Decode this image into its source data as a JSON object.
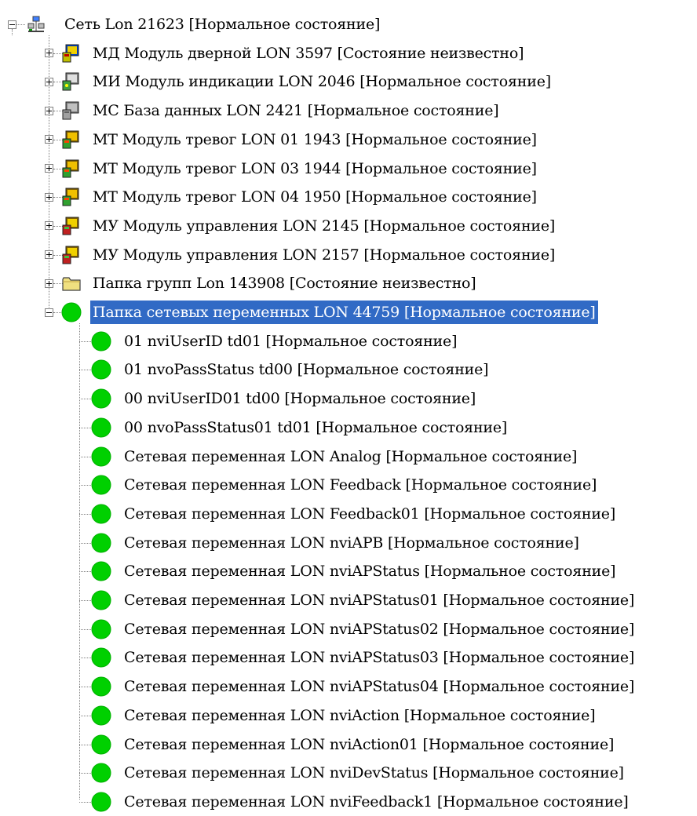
{
  "tree": {
    "root": {
      "label": "Сеть Lon 21623 [Нормальное состояние]",
      "icon": "network-icon",
      "expanded": true
    },
    "children": [
      {
        "label": "МД Модуль дверной LON 3597 [Состояние неизвестно]",
        "icon": "door-module-icon",
        "expanded": false
      },
      {
        "label": "МИ Модуль индикации LON 2046 [Нормальное состояние]",
        "icon": "indication-module-icon",
        "expanded": false
      },
      {
        "label": "МС База данных LON 2421 [Нормальное состояние]",
        "icon": "database-module-icon",
        "expanded": false
      },
      {
        "label": "МТ Модуль тревог LON 01 1943 [Нормальное состояние]",
        "icon": "alarm-module-icon",
        "expanded": false
      },
      {
        "label": "МТ Модуль тревог LON 03 1944 [Нормальное состояние]",
        "icon": "alarm-module-icon",
        "expanded": false
      },
      {
        "label": "МТ Модуль тревог LON 04 1950 [Нормальное состояние]",
        "icon": "alarm-module-icon",
        "expanded": false
      },
      {
        "label": "МУ Модуль управления LON 2145 [Нормальное состояние]",
        "icon": "control-module-icon",
        "expanded": false
      },
      {
        "label": "МУ Модуль управления LON 2157 [Нормальное состояние]",
        "icon": "control-module-icon",
        "expanded": false
      },
      {
        "label": "Папка групп Lon 143908 [Состояние неизвестно]",
        "icon": "folder-icon",
        "expanded": false
      },
      {
        "label": "Папка сетевых переменных LON 44759 [Нормальное состояние]",
        "icon": "status-ok-icon",
        "expanded": true,
        "selected": true
      }
    ],
    "variables": [
      {
        "label": "01 nviUserID td01 [Нормальное состояние]"
      },
      {
        "label": "01 nvoPassStatus td00 [Нормальное состояние]"
      },
      {
        "label": "00 nviUserID01 td00 [Нормальное состояние]"
      },
      {
        "label": "00 nvoPassStatus01 td01 [Нормальное состояние]"
      },
      {
        "label": "Сетевая переменная LON Analog [Нормальное состояние]"
      },
      {
        "label": "Сетевая переменная LON Feedback [Нормальное состояние]"
      },
      {
        "label": "Сетевая переменная LON Feedback01 [Нормальное состояние]"
      },
      {
        "label": "Сетевая переменная LON nviAPB [Нормальное состояние]"
      },
      {
        "label": "Сетевая переменная LON nviAPStatus [Нормальное состояние]"
      },
      {
        "label": "Сетевая переменная LON nviAPStatus01 [Нормальное состояние]"
      },
      {
        "label": "Сетевая переменная LON nviAPStatus02 [Нормальное состояние]"
      },
      {
        "label": "Сетевая переменная LON nviAPStatus03 [Нормальное состояние]"
      },
      {
        "label": "Сетевая переменная LON nviAPStatus04 [Нормальное состояние]"
      },
      {
        "label": "Сетевая переменная LON nviAction [Нормальное состояние]"
      },
      {
        "label": "Сетевая переменная LON nviAction01 [Нормальное состояние]"
      },
      {
        "label": "Сетевая переменная LON nviDevStatus [Нормальное состояние]"
      },
      {
        "label": "Сетевая переменная LON nviFeedback1 [Нормальное состояние]"
      }
    ]
  },
  "colors": {
    "selection": "#316ac5",
    "status_ok": "#00d000",
    "tree_line": "#808080"
  }
}
